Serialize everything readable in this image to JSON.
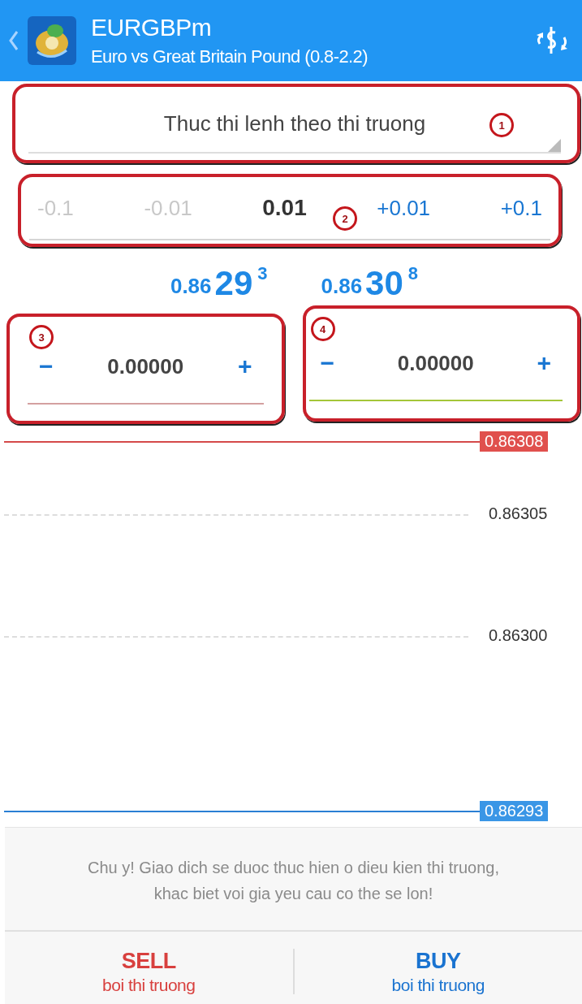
{
  "header": {
    "symbol": "EURGBPm",
    "description": "Euro vs Great Britain Pound (0.8-2.2)"
  },
  "order_type": {
    "value": "Thuc thi lenh theo thi truong",
    "callout": "1"
  },
  "volume": {
    "callout": "2",
    "steps": [
      {
        "kind": "step",
        "label": "-0.1",
        "disabled": true
      },
      {
        "kind": "step",
        "label": "-0.01",
        "disabled": true
      },
      {
        "kind": "value",
        "label": "0.01"
      },
      {
        "kind": "step",
        "label": "+0.01",
        "disabled": false
      },
      {
        "kind": "step",
        "label": "+0.1",
        "disabled": false
      }
    ]
  },
  "prices": [
    {
      "prefix": "0.86",
      "big": "29",
      "small": "3"
    },
    {
      "prefix": "0.86",
      "big": "30",
      "small": "8"
    }
  ],
  "stops": [
    {
      "callout": "3",
      "minus": "−",
      "value": "0.00000",
      "plus": "+",
      "color": "#d4a0a0"
    },
    {
      "callout": "4",
      "minus": "−",
      "value": "0.00000",
      "plus": "+",
      "color": "#a4c639"
    }
  ],
  "chart": {
    "levels": [
      {
        "kind": "ask",
        "label": "0.86308"
      },
      {
        "kind": "grid",
        "label": "0.86305"
      },
      {
        "kind": "grid",
        "label": "0.86300"
      },
      {
        "kind": "bid",
        "label": "0.86293"
      }
    ]
  },
  "notice": "Chu y! Giao dich se duoc thuc hien o dieu kien thi truong,\nkhac biet voi gia yeu cau co the se lon!",
  "actions": [
    {
      "kind": "sell",
      "label": "SELL",
      "sublabel": "boi thi truong"
    },
    {
      "kind": "buy",
      "label": "BUY",
      "sublabel": "boi thi truong"
    }
  ]
}
